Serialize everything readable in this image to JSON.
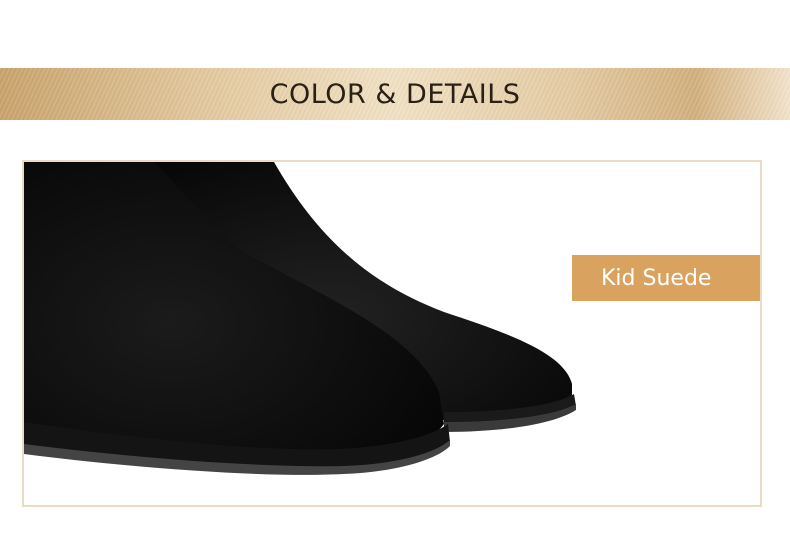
{
  "banner": {
    "title": "COLOR & DETAILS"
  },
  "detail": {
    "material_label": "Kid Suede"
  },
  "colors": {
    "banner_gold": "#e2c79c",
    "frame_border": "#eadcc4",
    "tag_background": "#d9a35f",
    "shoe_black": "#0b0b0b"
  },
  "image": {
    "subject": "black-suede-ankle-boots"
  }
}
